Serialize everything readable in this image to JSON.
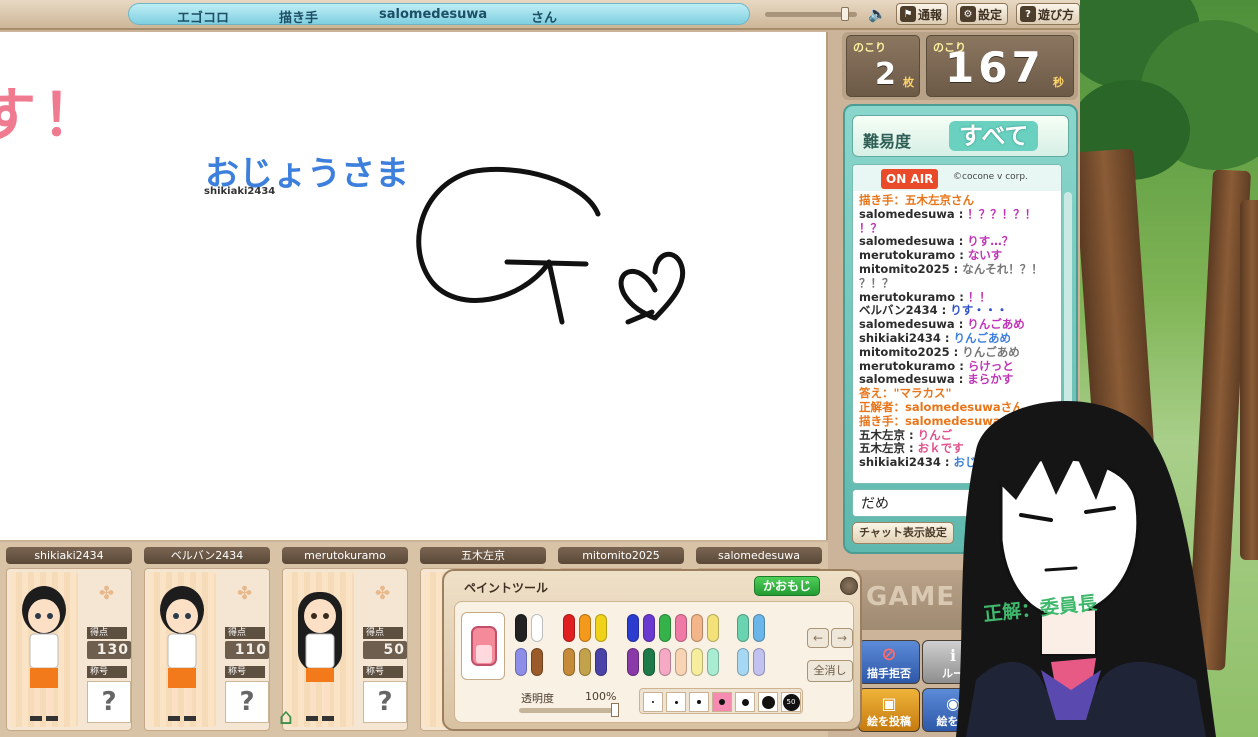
{
  "header": {
    "game_name": "エゴコロ",
    "role_label": "描き手",
    "drawer": "salomedesuwa",
    "honorific": "さん",
    "volume_level": 0.9,
    "buttons": [
      {
        "label": "通報",
        "icon": "flag-icon"
      },
      {
        "label": "設定",
        "icon": "gear-icon"
      },
      {
        "label": "遊び方",
        "icon": "question-icon"
      }
    ]
  },
  "canvas": {
    "heading_fragment": "す！",
    "answer_word": "おじょうさま",
    "answer_user": "shikiaki2434"
  },
  "counters": {
    "remaining_cards_label": "のこり",
    "remaining_cards": "2",
    "cards_unit": "枚",
    "remaining_time_label": "のこり",
    "remaining_time": "167",
    "time_unit": "秒"
  },
  "difficulty": {
    "label": "難易度",
    "value": "すべて"
  },
  "chat": {
    "onair": "ON AIR",
    "copyright": "©cocone v corp.",
    "lines": [
      {
        "text": "描き手：五木左京さん",
        "color": "#e8751a"
      },
      {
        "user": "salomedesuwa",
        "text": "！？？！？！",
        "color": "#c034b8"
      },
      {
        "text": "！？",
        "color": "#c034b8"
      },
      {
        "user": "salomedesuwa",
        "text": "りす…？",
        "color": "#c034b8"
      },
      {
        "user": "merutokuramo",
        "text": "ないす",
        "color": "#c034b8"
      },
      {
        "user": "mitomito2025",
        "text": "なんそれ！？！",
        "color": "#777777"
      },
      {
        "text": "？！？",
        "color": "#777777"
      },
      {
        "user": "merutokuramo",
        "text": "！！",
        "color": "#c034b8"
      },
      {
        "user": "ベルバン2434",
        "text": "りす・・・",
        "color": "#2f52c8"
      },
      {
        "user": "salomedesuwa",
        "text": "りんごあめ",
        "color": "#c034b8"
      },
      {
        "user": "shikiaki2434",
        "text": "りんごあめ",
        "color": "#3d7fdc"
      },
      {
        "user": "mitomito2025",
        "text": "りんごあめ",
        "color": "#777777"
      },
      {
        "user": "merutokuramo",
        "text": "らけっと",
        "color": "#c034b8"
      },
      {
        "user": "salomedesuwa",
        "text": "まらかす",
        "color": "#c034b8"
      },
      {
        "text": "答え：\"マラカス\"",
        "color": "#e8751a"
      },
      {
        "text": "正解者：salomedesuwaさん",
        "color": "#e8751a"
      },
      {
        "text": "描き手：salomedesuwa",
        "color": "#e8751a"
      },
      {
        "user": "五木左京",
        "text": "りんご",
        "color": "#e0508a"
      },
      {
        "user": "五木左京",
        "text": "おｋです",
        "color": "#e0508a"
      },
      {
        "user": "shikiaki2434",
        "text": "おじ",
        "color": "#3d7fdc"
      }
    ],
    "input_value": "だめ",
    "settings_label": "チャット表示設定"
  },
  "logo_text": "GAME",
  "actions": [
    {
      "label": "描手拒否",
      "icon": "no-icon"
    },
    {
      "label": "ルー",
      "icon": "rules-icon"
    },
    {
      "label": "絵を投稿",
      "icon": "picture-icon"
    },
    {
      "label": "絵を保",
      "icon": "camera-icon"
    }
  ],
  "players": [
    {
      "name": "shikiaki2434",
      "score_label": "得点",
      "score": "130",
      "title_label": "称号",
      "title": "?"
    },
    {
      "name": "ベルバン2434",
      "score_label": "得点",
      "score": "110",
      "title_label": "称号",
      "title": "?"
    },
    {
      "name": "merutokuramo",
      "score_label": "得点",
      "score": "50",
      "title_label": "称号",
      "title": "?"
    },
    {
      "name": "五木左京"
    },
    {
      "name": "mitomito2025"
    },
    {
      "name": "salomedesuwa"
    }
  ],
  "paint_tool": {
    "title": "ペイントツール",
    "kaomoji": "かおもじ",
    "clear": "全消し",
    "opacity_label": "透明度",
    "opacity_value": "100%",
    "opacity_level": 1.0,
    "size_max_label": "50",
    "pen_colors": [
      "#222222",
      "#ffffff",
      "#e02020",
      "#f39a1c",
      "#f1d21a",
      "#2c3ccf",
      "#6a3ad0",
      "#35b34a",
      "#f07aa6",
      "#f3b58a",
      "#f3e27a",
      "#6ad3b0",
      "#6ab6e8",
      "#8e8ee8",
      "#9a5a2a",
      "#c58a3a",
      "#c2a24a",
      "#4a44a8",
      "#8a3aa8",
      "#1f7a4a",
      "#f5a9c4",
      "#f8d3b4",
      "#f6ee9e",
      "#a8ecd2",
      "#a6d8f4",
      "#c2c2f0"
    ]
  },
  "overlay": {
    "answer": "正解：委員長"
  }
}
